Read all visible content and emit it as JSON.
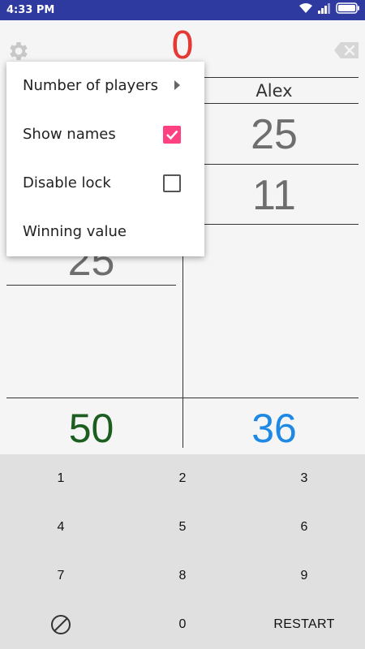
{
  "status_bar": {
    "time": "4:33 PM"
  },
  "header": {
    "center_score": "0"
  },
  "players": {
    "right": {
      "name": "Alex",
      "scores": [
        "25",
        "11"
      ],
      "total": "36"
    },
    "left": {
      "scores_partial": [
        "25"
      ],
      "total": "50"
    }
  },
  "menu": {
    "items": [
      {
        "label": "Number of players"
      },
      {
        "label": "Show names",
        "checked": true
      },
      {
        "label": "Disable lock",
        "checked": false
      },
      {
        "label": "Winning value"
      }
    ]
  },
  "keypad": {
    "keys": [
      "1",
      "2",
      "3",
      "4",
      "5",
      "6",
      "7",
      "8",
      "9",
      "0"
    ],
    "restart_label": "RESTART",
    "clear_icon": "no-entry-circle-icon"
  },
  "colors": {
    "status_bar": "#2e3aa0",
    "center_score": "#e53935",
    "left_total": "#1b5e20",
    "right_total": "#1e88e5",
    "checkbox_on": "#ff4081"
  }
}
